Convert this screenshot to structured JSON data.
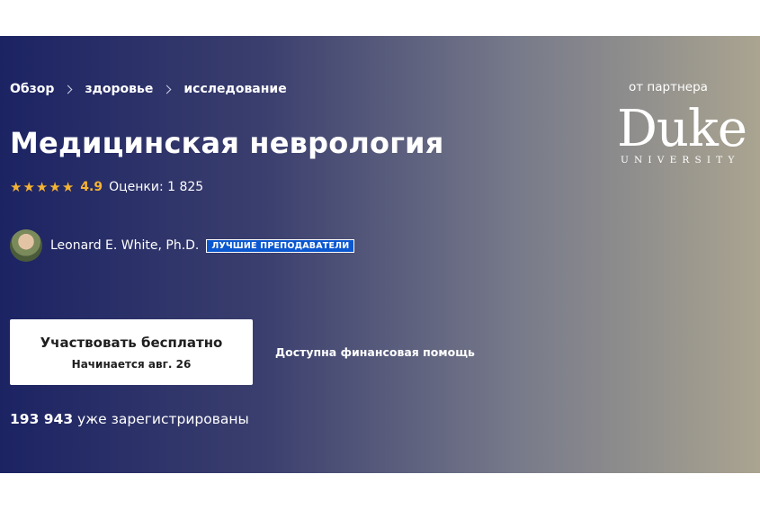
{
  "breadcrumb": {
    "items": [
      "Обзор",
      "здоровье",
      "исследование"
    ]
  },
  "course": {
    "title": "Медицинская неврология",
    "rating": {
      "stars": 5,
      "value": "4.9",
      "count_text": "Оценки: 1 825"
    }
  },
  "instructor": {
    "name": "Leonard E. White, Ph.D.",
    "badge": "ЛУЧШИЕ ПРЕПОДАВАТЕЛИ"
  },
  "enroll": {
    "main_label": "Участвовать бесплатно",
    "sub_label": "Начинается авг. 26"
  },
  "financial_aid": "Доступна финансовая помощь",
  "enrolled": {
    "count": "193 943",
    "text": " уже зарегистрированы"
  },
  "partner": {
    "label": "от партнера",
    "logo_word": "Duke",
    "logo_sub": "UNIVERSITY"
  },
  "colors": {
    "star": "#f5b335",
    "badge_bg": "#0b57d0",
    "gradient_start": "#1c2363",
    "gradient_end": "#aaa490"
  }
}
